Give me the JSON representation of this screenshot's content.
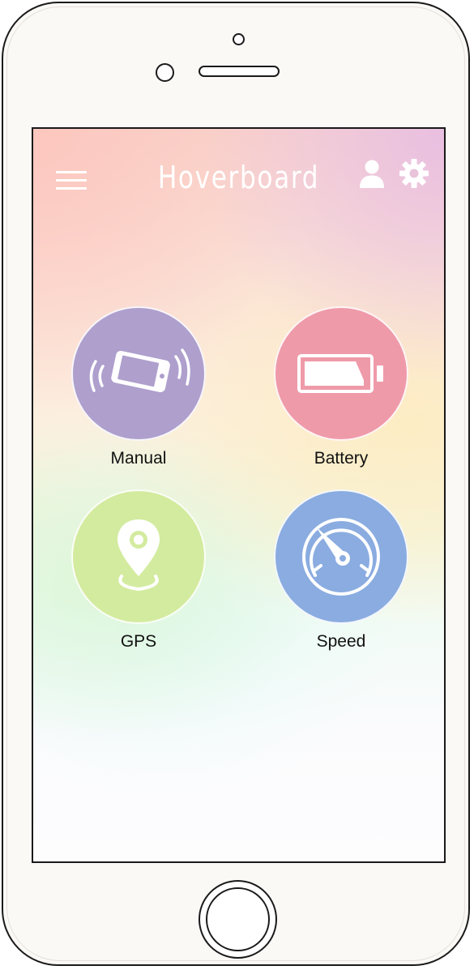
{
  "app": {
    "title": "Hoverboard"
  },
  "header": {
    "menu_icon": "hamburger-menu-icon",
    "profile_icon": "user-icon",
    "settings_icon": "gear-icon"
  },
  "tiles": [
    {
      "label": "Manual",
      "icon": "phone-tilt-icon",
      "color": "#ae9fcd"
    },
    {
      "label": "Battery",
      "icon": "battery-icon",
      "color": "#ef9aa9"
    },
    {
      "label": "GPS",
      "icon": "location-pin-icon",
      "color": "#d3eb9f"
    },
    {
      "label": "Speed",
      "icon": "speedometer-icon",
      "color": "#8aace0"
    }
  ],
  "colors": {
    "icon_foreground": "#ffffff",
    "label_text": "#111111"
  }
}
